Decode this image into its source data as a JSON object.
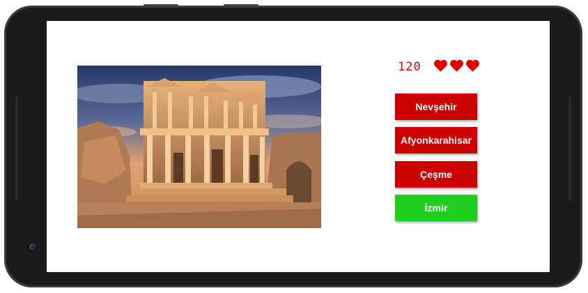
{
  "game": {
    "score": "120",
    "lives": 3,
    "accent_color": "#e00000"
  },
  "question": {
    "image_icon": "ancient-library-ruins-photo"
  },
  "answers": [
    {
      "label": "Nevşehir",
      "color": "#cc0000"
    },
    {
      "label": "Afyonkarahisar",
      "color": "#cc0000"
    },
    {
      "label": "Çeşme",
      "color": "#cc0000"
    },
    {
      "label": "İzmir",
      "color": "#1fd01f"
    }
  ]
}
